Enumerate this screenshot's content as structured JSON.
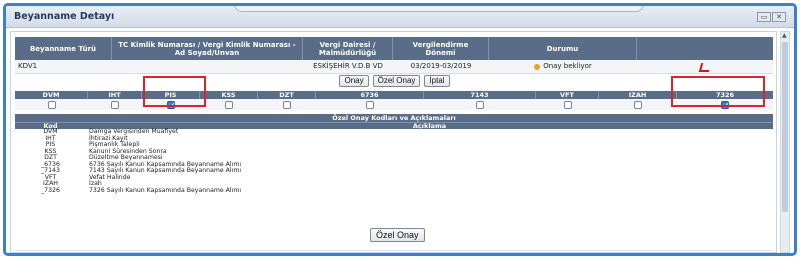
{
  "window": {
    "title": "Beyanname Detayı"
  },
  "main_table": {
    "headers": [
      "Beyanname Türü",
      "TC Kimlik Numarası / Vergi Kimlik Numarası - Ad Soyad/Unvan",
      "Vergi Dairesi / Malmüdürlüğü",
      "Vergilendirme Dönemi",
      "Durumu",
      ""
    ],
    "row": {
      "type": "KDV1",
      "tc_vkn": "",
      "office": "ESKİŞEHİR V.D.B VD",
      "period": "03/2019-03/2019",
      "status": "Onay bekliyor",
      "pdf_icon": "pdf-icon"
    }
  },
  "actions": {
    "approve": "Onay",
    "special_approve": "Özel Onay",
    "cancel": "İptal"
  },
  "codes": [
    {
      "label": "DVM",
      "checked": false
    },
    {
      "label": "IHT",
      "checked": false
    },
    {
      "label": "PIS",
      "checked": true
    },
    {
      "label": "KSS",
      "checked": false
    },
    {
      "label": "DZT",
      "checked": false
    },
    {
      "label": "6736",
      "checked": false
    },
    {
      "label": "7143",
      "checked": false
    },
    {
      "label": "VFT",
      "checked": false
    },
    {
      "label": "IZAH",
      "checked": false
    },
    {
      "label": "7326",
      "checked": true
    }
  ],
  "explanations": {
    "title": "Özel Onay Kodları ve Açıklamaları",
    "col_code": "Kod",
    "col_desc": "Açıklama",
    "rows": [
      {
        "code": "DVM",
        "desc": "Damga Vergisinden Muafiyet"
      },
      {
        "code": "IHT",
        "desc": "İhtirazi Kayıt"
      },
      {
        "code": "PIS",
        "desc": "Pişmanlık Talepli"
      },
      {
        "code": "KSS",
        "desc": "Kanuni Süresinden Sonra"
      },
      {
        "code": "DZT",
        "desc": "Düzeltme Beyannamesi"
      },
      {
        "code": "_6736",
        "desc": "6736 Sayılı Kanun Kapsamında Beyanname Alımı"
      },
      {
        "code": "_7143",
        "desc": "7143 Sayılı Kanun Kapsamında Beyanname Alımı"
      },
      {
        "code": "VFT",
        "desc": "Vefat Halinde"
      },
      {
        "code": "IZAH",
        "desc": "İzah"
      },
      {
        "code": "_7326",
        "desc": "7326 Sayılı Kanun Kapsamında Beyanname Alımı"
      }
    ]
  },
  "bottom_action": "Özel Onay",
  "colors": {
    "header_bg": "#5a6d88",
    "highlight": "#d8262c",
    "frame": "#3a7fd0",
    "checked": "#2f7fd6"
  }
}
